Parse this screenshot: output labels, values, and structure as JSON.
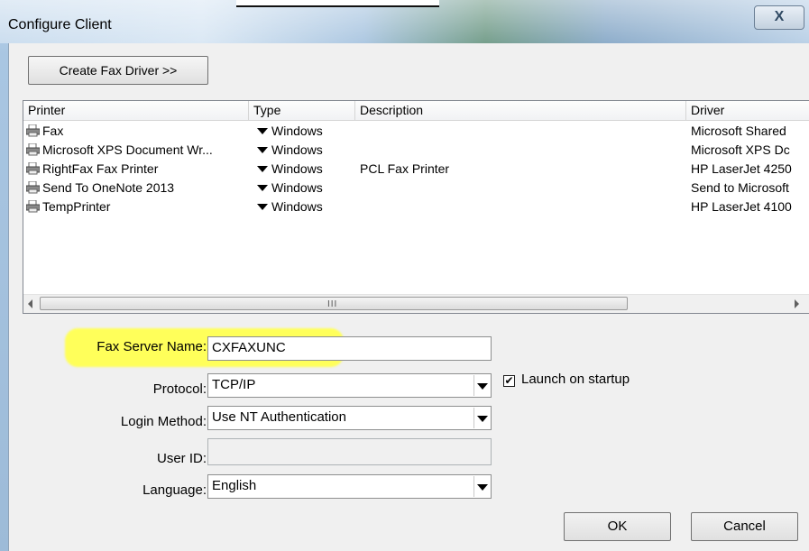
{
  "window": {
    "title": "Configure Client",
    "close_glyph": "X"
  },
  "toolbar": {
    "create_fax_driver_label": "Create Fax Driver >>"
  },
  "printer_list": {
    "columns": [
      "Printer",
      "Type",
      "Description",
      "Driver"
    ],
    "rows": [
      {
        "printer": "Fax",
        "type": "Windows",
        "description": "",
        "driver": "Microsoft Shared"
      },
      {
        "printer": "Microsoft XPS Document Wr...",
        "type": "Windows",
        "description": "",
        "driver": "Microsoft XPS Dc"
      },
      {
        "printer": "RightFax Fax Printer",
        "type": "Windows",
        "description": "PCL Fax Printer",
        "driver": "HP LaserJet 4250"
      },
      {
        "printer": "Send To OneNote 2013",
        "type": "Windows",
        "description": "",
        "driver": "Send to Microsoft"
      },
      {
        "printer": "TempPrinter",
        "type": "Windows",
        "description": "",
        "driver": "HP LaserJet 4100"
      }
    ],
    "scroll_grip": "III"
  },
  "form": {
    "fax_server_name_label": "Fax Server Name:",
    "fax_server_name_value": "CXFAXUNC",
    "protocol_label": "Protocol:",
    "protocol_value": "TCP/IP",
    "launch_on_startup_label": "Launch on startup",
    "launch_on_startup_checked": true,
    "login_method_label": "Login Method:",
    "login_method_value": "Use NT Authentication",
    "user_id_label": "User ID:",
    "user_id_value": "",
    "language_label": "Language:",
    "language_value": "English"
  },
  "buttons": {
    "ok": "OK",
    "cancel": "Cancel"
  },
  "colors": {
    "highlight": "#ffff5a",
    "dialog_face": "#f0f0f0",
    "titlebar": "#b9d3ea"
  },
  "icons": {
    "printer": "printer-icon",
    "close": "close-icon",
    "dropdown": "chevron-down-icon",
    "check": "checkmark-icon"
  }
}
